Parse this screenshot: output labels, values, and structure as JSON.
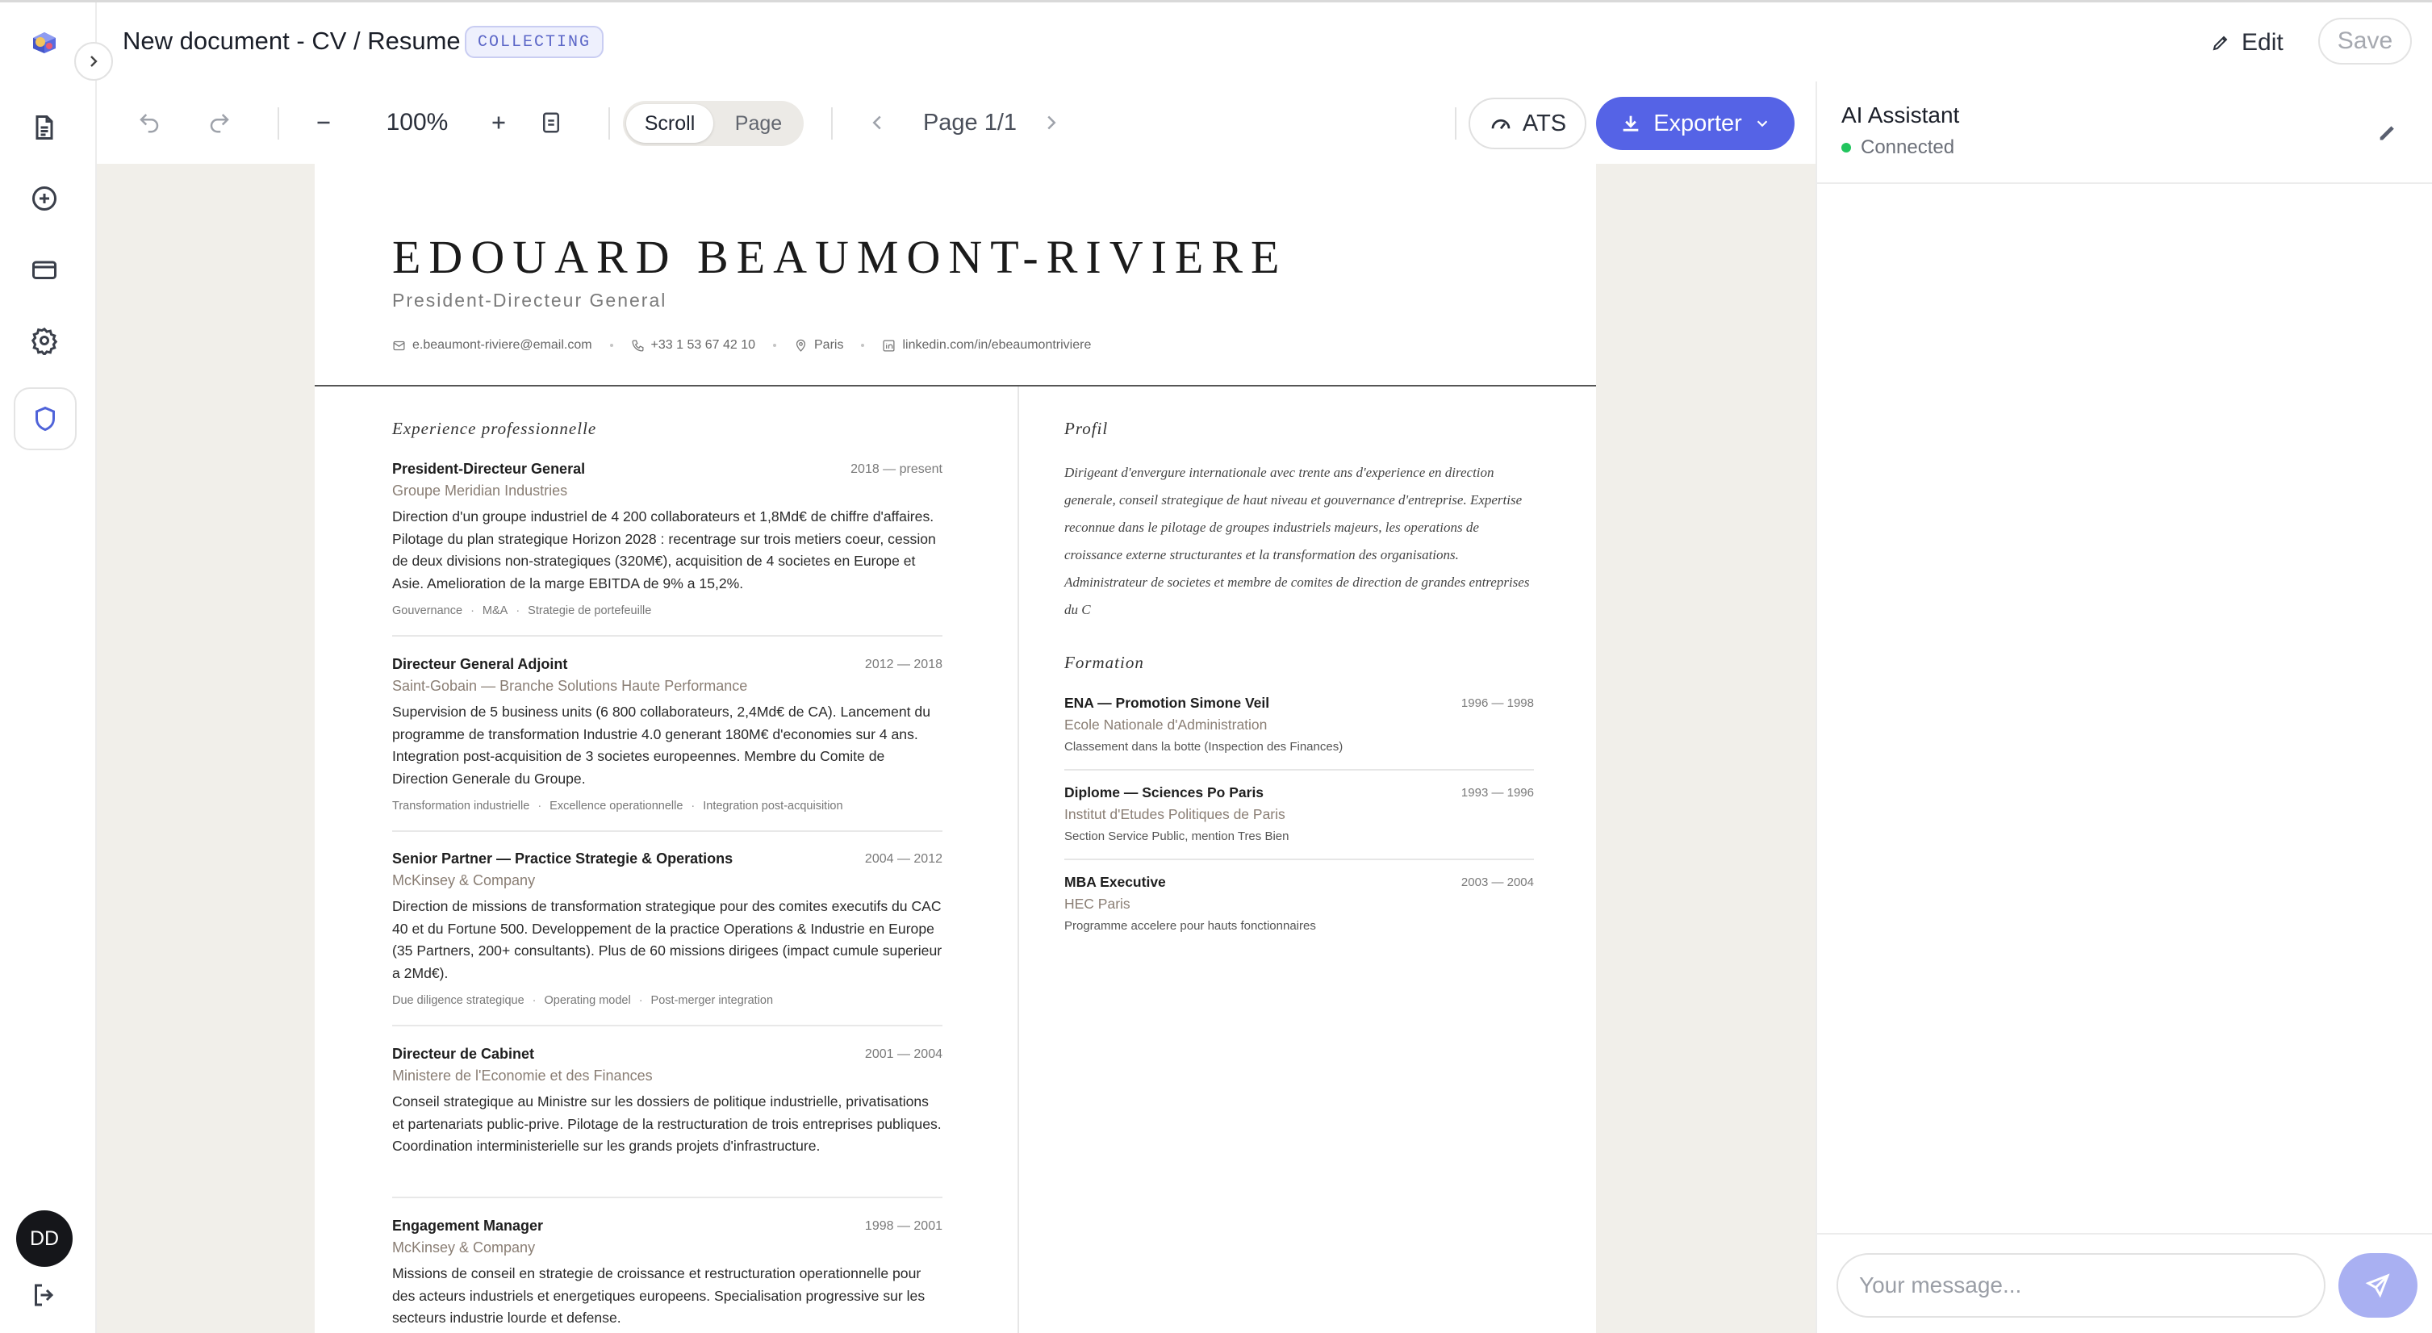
{
  "header": {
    "title": "New document - CV / Resume",
    "status_badge": "COLLECTING",
    "edit_label": "Edit",
    "save_label": "Save"
  },
  "sidebar": {
    "icons": [
      "document-icon",
      "plus-circle-icon",
      "credit-card-icon",
      "gear-icon",
      "shield-icon"
    ],
    "active": "shield-icon",
    "avatar_initials": "DD"
  },
  "toolbar": {
    "zoom": "100%",
    "view_modes": [
      "Scroll",
      "Page"
    ],
    "active_view": "Scroll",
    "page_indicator": "Page 1/1",
    "ats_label": "ATS",
    "export_label": "Exporter"
  },
  "resume": {
    "name": "EDOUARD BEAUMONT-RIVIERE",
    "title": "President-Directeur General",
    "contacts": {
      "email": "e.beaumont-riviere@email.com",
      "phone": "+33 1 53 67 42 10",
      "city": "Paris",
      "linkedin": "linkedin.com/in/ebeaumontriviere"
    },
    "experience_heading": "Experience professionnelle",
    "experience": [
      {
        "title": "President-Directeur General",
        "dates": "2018 — present",
        "org": "Groupe Meridian Industries",
        "desc": "Direction d'un groupe industriel de 4 200 collaborateurs et 1,8Md€ de chiffre d'affaires. Pilotage du plan strategique Horizon 2028 : recentrage sur trois metiers coeur, cession de deux divisions non-strategiques (320M€), acquisition de 4 societes en Europe et Asie. Amelioration de la marge EBITDA de 9% a 15,2%.",
        "tags": [
          "Gouvernance",
          "M&A",
          "Strategie de portefeuille"
        ]
      },
      {
        "title": "Directeur General Adjoint",
        "dates": "2012 — 2018",
        "org": "Saint-Gobain — Branche Solutions Haute Performance",
        "desc": "Supervision de 5 business units (6 800 collaborateurs, 2,4Md€ de CA). Lancement du programme de transformation Industrie 4.0 generant 180M€ d'economies sur 4 ans. Integration post-acquisition de 3 societes europeennes. Membre du Comite de Direction Generale du Groupe.",
        "tags": [
          "Transformation industrielle",
          "Excellence operationnelle",
          "Integration post-acquisition"
        ]
      },
      {
        "title": "Senior Partner — Practice Strategie & Operations",
        "dates": "2004 — 2012",
        "org": "McKinsey & Company",
        "desc": "Direction de missions de transformation strategique pour des comites executifs du CAC 40 et du Fortune 500. Developpement de la practice Operations & Industrie en Europe (35 Partners, 200+ consultants). Plus de 60 missions dirigees (impact cumule superieur a 2Md€).",
        "tags": [
          "Due diligence strategique",
          "Operating model",
          "Post-merger integration"
        ]
      },
      {
        "title": "Directeur de Cabinet",
        "dates": "2001 — 2004",
        "org": "Ministere de l'Economie et des Finances",
        "desc": "Conseil strategique au Ministre sur les dossiers de politique industrielle, privatisations et partenariats public-prive. Pilotage de la restructuration de trois entreprises publiques. Coordination interministerielle sur les grands projets d'infrastructure.",
        "tags": []
      },
      {
        "title": "Engagement Manager",
        "dates": "1998 — 2001",
        "org": "McKinsey & Company",
        "desc": "Missions de conseil en strategie de croissance et restructuration operationnelle pour des acteurs industriels et energetiques europeens. Specialisation progressive sur les secteurs industrie lourde et defense.",
        "tags": []
      }
    ],
    "profile_heading": "Profil",
    "profile_text": "Dirigeant d'envergure internationale avec trente ans d'experience en direction generale, conseil strategique de haut niveau et gouvernance d'entreprise. Expertise reconnue dans le pilotage de groupes industriels majeurs, les operations de croissance externe structurantes et la transformation des organisations. Administrateur de societes et membre de comites de direction de grandes entreprises du C",
    "education_heading": "Formation",
    "education": [
      {
        "title": "ENA — Promotion Simone Veil",
        "dates": "1996 — 1998",
        "school": "Ecole Nationale d'Administration",
        "note": "Classement dans la botte (Inspection des Finances)"
      },
      {
        "title": "Diplome — Sciences Po Paris",
        "dates": "1993 — 1996",
        "school": "Institut d'Etudes Politiques de Paris",
        "note": "Section Service Public, mention Tres Bien"
      },
      {
        "title": "MBA Executive",
        "dates": "2003 — 2004",
        "school": "HEC Paris",
        "note": "Programme accelere pour hauts fonctionnaires"
      }
    ]
  },
  "assistant": {
    "title": "AI Assistant",
    "status": "Connected",
    "input_placeholder": "Your message..."
  },
  "colors": {
    "accent": "#5563e6",
    "send_button": "#a9b0f2",
    "status_online": "#22c55e",
    "canvas_bg": "#f1efea"
  }
}
